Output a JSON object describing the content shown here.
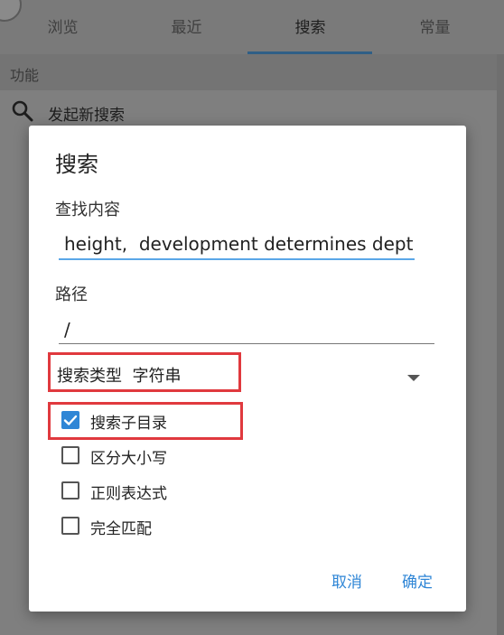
{
  "tabs": [
    {
      "label": "浏览"
    },
    {
      "label": "最近"
    },
    {
      "label": "搜索"
    },
    {
      "label": "常量"
    }
  ],
  "section": {
    "label": "功能"
  },
  "action": {
    "label": "发起新搜索",
    "icon": "search-icon"
  },
  "dialog": {
    "title": "搜索",
    "query_label": "查找内容",
    "query_value": "height,  development determines depth.",
    "path_label": "路径",
    "path_value": "/",
    "type_label": "搜索类型",
    "type_value": "字符串",
    "options": [
      {
        "label": "搜索子目录",
        "checked": true
      },
      {
        "label": "区分大小写",
        "checked": false
      },
      {
        "label": "正则表达式",
        "checked": false
      },
      {
        "label": "完全匹配",
        "checked": false
      }
    ],
    "cancel_label": "取消",
    "ok_label": "确定"
  },
  "colors": {
    "accent": "#2f86d6",
    "highlight_box": "#e0393e",
    "active_underline": "#5aa7e8"
  }
}
